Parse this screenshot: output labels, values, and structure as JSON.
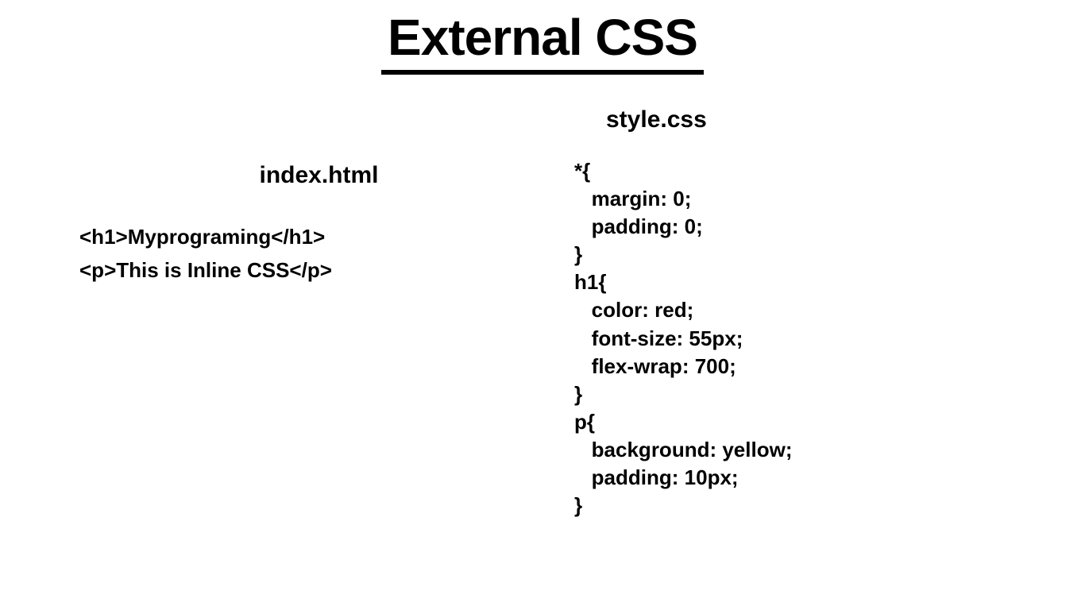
{
  "title": "External CSS",
  "left": {
    "filename": "index.html",
    "lines": [
      "<h1>Myprograming</h1>",
      "<p>This is Inline CSS</p>"
    ]
  },
  "right": {
    "filename": "style.css",
    "lines": [
      "*{",
      "   margin: 0;",
      "   padding: 0;",
      "}",
      "",
      "h1{",
      "   color: red;",
      "   font-size: 55px;",
      "   flex-wrap: 700;",
      "}",
      "p{",
      "   background: yellow;",
      "   padding: 10px;",
      "}"
    ]
  }
}
